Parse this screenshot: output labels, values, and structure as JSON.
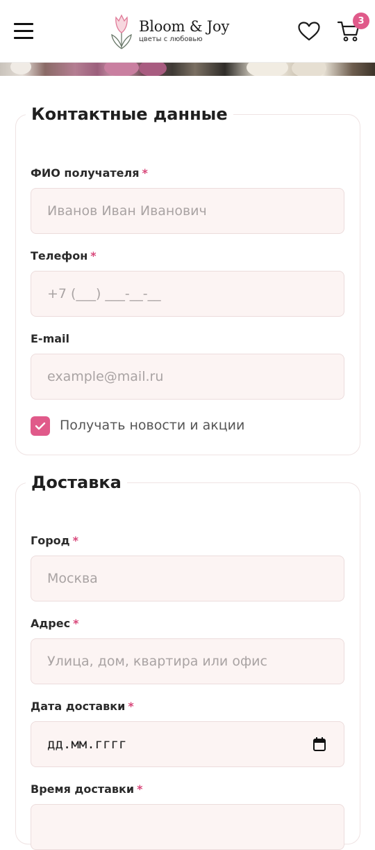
{
  "header": {
    "logo_name": "Bloom & Joy",
    "logo_tagline": "цветы с любовью",
    "cart_count": "3"
  },
  "colors": {
    "accent": "#e05a8a",
    "field_bg": "#fcf4f3",
    "card_border": "#efe3e3"
  },
  "contact": {
    "title": "Контактные данные",
    "name_label": "ФИО получателя",
    "name_placeholder": "Иванов Иван Иванович",
    "phone_label": "Телефон",
    "phone_placeholder": "+7 (___) ___-__-__",
    "email_label": "E-mail",
    "email_placeholder": "example@mail.ru",
    "newsletter_label": "Получать новости и акции",
    "newsletter_checked": true
  },
  "delivery": {
    "title": "Доставка",
    "city_label": "Город",
    "city_placeholder": "Москва",
    "address_label": "Адрес",
    "address_placeholder": "Улица, дом, квартира или офис",
    "date_label": "Дата доставки",
    "date_placeholder": "дд.мм.гггг",
    "time_label": "Время доставки"
  },
  "required_mark": "*",
  "icons": {
    "menu": "hamburger-menu-icon",
    "logo": "tulip-logo-icon",
    "favorites": "heart-icon",
    "cart": "shopping-cart-icon",
    "checkbox": "checkmark-icon",
    "date": "calendar-icon"
  }
}
